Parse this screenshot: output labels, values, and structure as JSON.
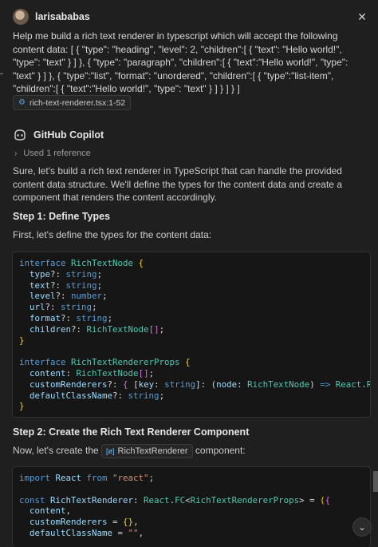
{
  "user": {
    "name": "larisababas",
    "message": "Help me build a rich text renderer in typescript which will accept the following content data: [ { \"type\": \"heading\", \"level\": 2, \"children\":[ { \"text\": \"Hello world!\", \"type\": \"text\" } ] }, { \"type\": \"paragraph\", \"children\":[ { \"text\":\"Hello world!\", \"type\": \"text\" } ] }, { \"type\":\"list\", \"format\": \"unordered\", \"children\":[ { \"type\":\"list-item\", \"children\":[ { \"text\":\"Hello world!\", \"type\": \"text\" } ] } ] } ]",
    "file_reference": "rich-text-renderer.tsx:1-52",
    "file_icon": "gear-icon"
  },
  "assistant": {
    "name": "GitHub Copilot",
    "references_label": "Used 1 reference",
    "intro": "Sure, let's build a rich text renderer in TypeScript that can handle the provided content data structure. We'll define the types for the content data and create a component that renders the content accordingly.",
    "step1_title": "Step 1: Define Types",
    "step1_text": "First, let's define the types for the content data:",
    "step2_title": "Step 2: Create the Rich Text Renderer Component",
    "step2_before": "Now, let's create the",
    "step2_symbol": "RichTextRenderer",
    "step2_after": "component:"
  },
  "colors": {
    "background": "#1f1f1f",
    "code_background": "#161616",
    "keyword": "#569cd6",
    "type": "#4ec9b0",
    "property": "#9cdcfe",
    "string": "#ce9178"
  },
  "code1": [
    [
      [
        "kw",
        "interface "
      ],
      [
        "ty",
        "RichTextNode "
      ],
      [
        "br",
        "{"
      ]
    ],
    [
      [
        "t",
        "  "
      ],
      [
        "pn",
        "type"
      ],
      [
        "t",
        "?: "
      ],
      [
        "kw",
        "string"
      ],
      [
        "t",
        ";"
      ]
    ],
    [
      [
        "t",
        "  "
      ],
      [
        "pn",
        "text"
      ],
      [
        "t",
        "?: "
      ],
      [
        "kw",
        "string"
      ],
      [
        "t",
        ";"
      ]
    ],
    [
      [
        "t",
        "  "
      ],
      [
        "pn",
        "level"
      ],
      [
        "t",
        "?: "
      ],
      [
        "kw",
        "number"
      ],
      [
        "t",
        ";"
      ]
    ],
    [
      [
        "t",
        "  "
      ],
      [
        "pn",
        "url"
      ],
      [
        "t",
        "?: "
      ],
      [
        "kw",
        "string"
      ],
      [
        "t",
        ";"
      ]
    ],
    [
      [
        "t",
        "  "
      ],
      [
        "pn",
        "format"
      ],
      [
        "t",
        "?: "
      ],
      [
        "kw",
        "string"
      ],
      [
        "t",
        ";"
      ]
    ],
    [
      [
        "t",
        "  "
      ],
      [
        "pn",
        "children"
      ],
      [
        "t",
        "?: "
      ],
      [
        "ty",
        "RichTextNode"
      ],
      [
        "br2",
        "[]"
      ],
      [
        "t",
        ";"
      ]
    ],
    [
      [
        "br",
        "}"
      ]
    ],
    [
      [
        "t",
        ""
      ]
    ],
    [
      [
        "kw",
        "interface "
      ],
      [
        "ty",
        "RichTextRendererProps "
      ],
      [
        "br",
        "{"
      ]
    ],
    [
      [
        "t",
        "  "
      ],
      [
        "pn",
        "content"
      ],
      [
        "t",
        ": "
      ],
      [
        "ty",
        "RichTextNode"
      ],
      [
        "br2",
        "[]"
      ],
      [
        "t",
        ";"
      ]
    ],
    [
      [
        "t",
        "  "
      ],
      [
        "pn",
        "customRenderers"
      ],
      [
        "t",
        "?: "
      ],
      [
        "br2",
        "{ "
      ],
      [
        "t",
        "["
      ],
      [
        "pn",
        "key"
      ],
      [
        "t",
        ": "
      ],
      [
        "kw",
        "string"
      ],
      [
        "t",
        "]: ("
      ],
      [
        "pn",
        "node"
      ],
      [
        "t",
        ": "
      ],
      [
        "ty",
        "RichTextNode"
      ],
      [
        "t",
        ") "
      ],
      [
        "kw",
        "=> "
      ],
      [
        "ty",
        "React"
      ],
      [
        "t",
        "."
      ],
      [
        "ty",
        "ReactNode"
      ]
    ],
    [
      [
        "t",
        "  "
      ],
      [
        "pn",
        "defaultClassName"
      ],
      [
        "t",
        "?: "
      ],
      [
        "kw",
        "string"
      ],
      [
        "t",
        ";"
      ]
    ],
    [
      [
        "br",
        "}"
      ]
    ]
  ],
  "code2": [
    [
      [
        "kw",
        "import "
      ],
      [
        "pn",
        "React "
      ],
      [
        "kw",
        "from "
      ],
      [
        "st",
        "\"react\""
      ],
      [
        "t",
        ";"
      ]
    ],
    [
      [
        "t",
        ""
      ]
    ],
    [
      [
        "kw",
        "const "
      ],
      [
        "pn",
        "RichTextRenderer"
      ],
      [
        "t",
        ": "
      ],
      [
        "ty",
        "React"
      ],
      [
        "t",
        "."
      ],
      [
        "ty",
        "FC"
      ],
      [
        "t",
        "<"
      ],
      [
        "ty",
        "RichTextRendererProps"
      ],
      [
        "t",
        "> = "
      ],
      [
        "br",
        "("
      ],
      [
        "br2",
        "{"
      ]
    ],
    [
      [
        "t",
        "  "
      ],
      [
        "pn",
        "content"
      ],
      [
        "t",
        ","
      ]
    ],
    [
      [
        "t",
        "  "
      ],
      [
        "pn",
        "customRenderers "
      ],
      [
        "t",
        "= "
      ],
      [
        "br",
        "{}"
      ],
      [
        "t",
        ","
      ]
    ],
    [
      [
        "t",
        "  "
      ],
      [
        "pn",
        "defaultClassName "
      ],
      [
        "t",
        "= "
      ],
      [
        "st",
        "\"\""
      ],
      [
        "t",
        ","
      ]
    ]
  ]
}
